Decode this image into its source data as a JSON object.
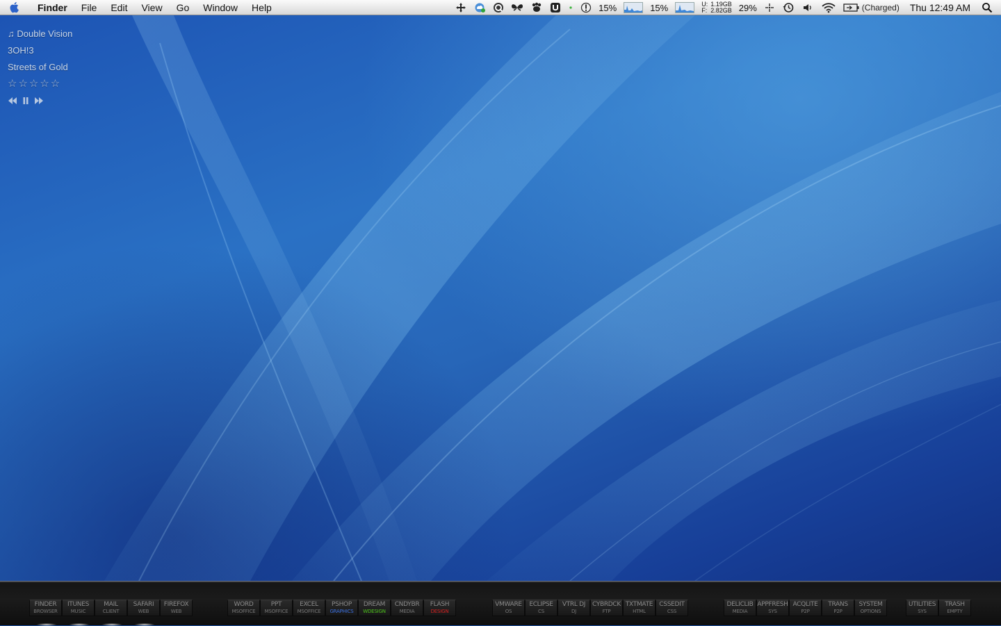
{
  "menubar": {
    "app_name": "Finder",
    "menus": [
      "File",
      "Edit",
      "View",
      "Go",
      "Window",
      "Help"
    ],
    "status": {
      "cpu1": "15%",
      "cpu2": "15%",
      "mem_u_label": "U:",
      "mem_f_label": "F:",
      "mem_used": "1.19GB",
      "mem_free": "2.82GB",
      "volume_pct": "29%",
      "battery": "(Charged)",
      "clock": "Thu 12:49 AM"
    },
    "icons": [
      "apple-icon",
      "move-icon",
      "cloud-icon",
      "quicksilver-icon",
      "butterfly-icon",
      "growl-icon",
      "u-icon",
      "dot-icon",
      "alert-icon",
      "cpu-graph-icon",
      "time-machine-icon",
      "volume-icon",
      "wifi-icon",
      "battery-icon",
      "spotlight-icon"
    ]
  },
  "nowplaying": {
    "song": "Double Vision",
    "artist": "3OH!3",
    "album": "Streets of Gold",
    "rating_stars": 0,
    "stars": "☆☆☆☆☆"
  },
  "launcher": {
    "groups": [
      [
        {
          "label": "FINDER",
          "sub": "BROWSER",
          "color": "#777777"
        },
        {
          "label": "ITUNES",
          "sub": "MUSIC",
          "color": "#777777"
        },
        {
          "label": "MAIL",
          "sub": "CLIENT",
          "color": "#777777"
        },
        {
          "label": "SAFARI",
          "sub": "WEB",
          "color": "#777777"
        },
        {
          "label": "FIREFOX",
          "sub": "WEB",
          "color": "#777777"
        }
      ],
      [
        {
          "label": "WORD",
          "sub": "MSOFFICE",
          "color": "#777777"
        },
        {
          "label": "PPT",
          "sub": "MSOFFICE",
          "color": "#777777"
        },
        {
          "label": "EXCEL",
          "sub": "MSOFFICE",
          "color": "#777777"
        },
        {
          "label": "PSHOP",
          "sub": "GRAPHICS",
          "color": "#3a6fe0"
        },
        {
          "label": "DREAM",
          "sub": "WDESIGN",
          "color": "#4cc21a"
        },
        {
          "label": "CNDYBR",
          "sub": "MEDIA",
          "color": "#777777"
        },
        {
          "label": "FLASH",
          "sub": "DESIGN",
          "color": "#d42020"
        }
      ],
      [
        {
          "label": "VMWARE",
          "sub": "OS",
          "color": "#777777"
        },
        {
          "label": "ECLIPSE",
          "sub": "CS",
          "color": "#777777"
        },
        {
          "label": "VTRL DJ",
          "sub": "DJ",
          "color": "#777777"
        },
        {
          "label": "CYBRDCK",
          "sub": "FTP",
          "color": "#777777"
        },
        {
          "label": "TXTMATE",
          "sub": "HTML",
          "color": "#777777"
        },
        {
          "label": "CSSEDIT",
          "sub": "CSS",
          "color": "#777777"
        }
      ],
      [
        {
          "label": "DELICLIB",
          "sub": "MEDIA",
          "color": "#777777"
        },
        {
          "label": "APPFRESH",
          "sub": "SYS",
          "color": "#777777"
        },
        {
          "label": "ACQLITE",
          "sub": "P2P",
          "color": "#777777"
        },
        {
          "label": "TRANS",
          "sub": "P2P",
          "color": "#777777"
        },
        {
          "label": "SYSTEM",
          "sub": "OPTIONS",
          "color": "#777777"
        }
      ],
      [
        {
          "label": "UTILITIES",
          "sub": "SYS",
          "color": "#777777"
        },
        {
          "label": "TRASH",
          "sub": "EMPTY",
          "color": "#777777"
        }
      ]
    ]
  }
}
